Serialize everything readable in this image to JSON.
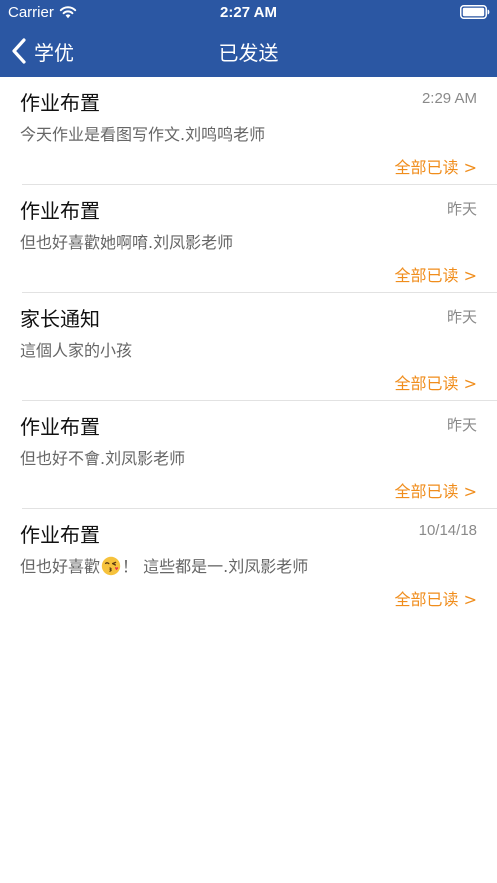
{
  "status_bar": {
    "carrier": "Carrier",
    "time": "2:27 AM"
  },
  "nav": {
    "back_label": "学优",
    "title": "已发送"
  },
  "colors": {
    "nav_background": "#2b57a3",
    "read_status": "#f08d1c"
  },
  "messages": [
    {
      "title": "作业布置",
      "time": "2:29 AM",
      "body": "今天作业是看图写作文.刘鸣鸣老师",
      "status": "全部已读 >"
    },
    {
      "title": "作业布置",
      "time": "昨天",
      "body": "但也好喜歡她啊唷.刘凤影老师",
      "status": "全部已读 >"
    },
    {
      "title": "家长通知",
      "time": "昨天",
      "body": "這個人家的小孩",
      "status": "全部已读 >"
    },
    {
      "title": "作业布置",
      "time": "昨天",
      "body": "但也好不會.刘凤影老师",
      "status": "全部已读 >"
    },
    {
      "title": "作业布置",
      "time": "10/14/18",
      "body_before_emoji": "但也好喜歡",
      "body_emoji": "kissing-face-emoji",
      "body_after_emoji": "！ 這些都是一.刘凤影老师",
      "status": "全部已读 >"
    }
  ]
}
